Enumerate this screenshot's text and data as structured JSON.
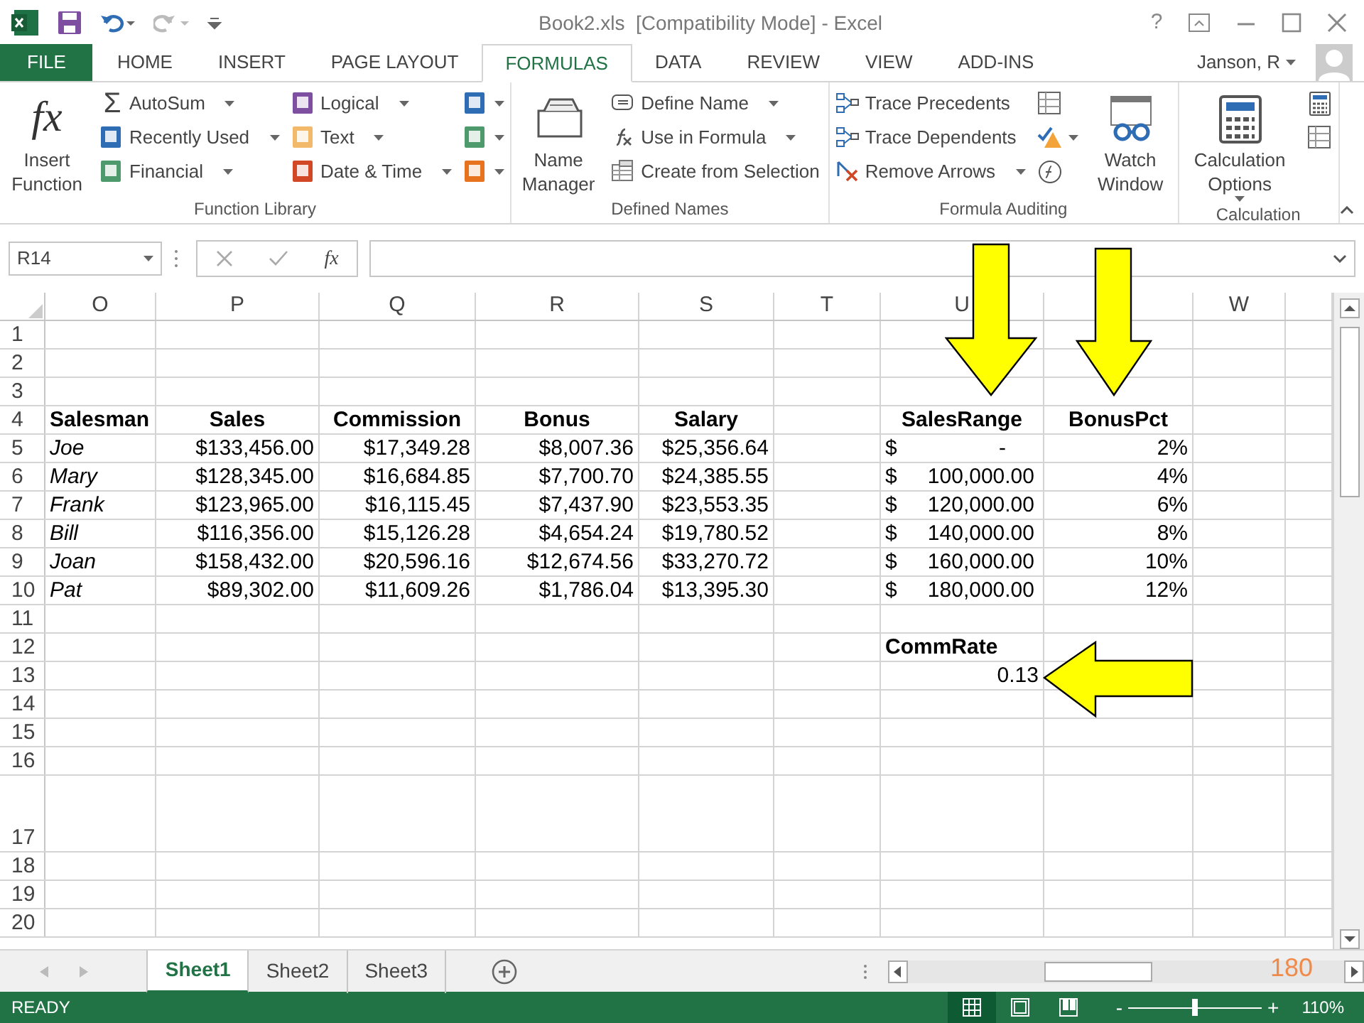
{
  "title_bar": {
    "title": "Book2.xls  [Compatibility Mode] - Excel",
    "help": "?"
  },
  "menu_tabs": [
    {
      "label": "FILE",
      "kind": "file",
      "selected": false
    },
    {
      "label": "HOME",
      "kind": "tab",
      "selected": false
    },
    {
      "label": "INSERT",
      "kind": "tab",
      "selected": false
    },
    {
      "label": "PAGE LAYOUT",
      "kind": "tab",
      "selected": false
    },
    {
      "label": "FORMULAS",
      "kind": "tab",
      "selected": true
    },
    {
      "label": "DATA",
      "kind": "tab",
      "selected": false
    },
    {
      "label": "REVIEW",
      "kind": "tab",
      "selected": false
    },
    {
      "label": "VIEW",
      "kind": "tab",
      "selected": false
    },
    {
      "label": "ADD-INS",
      "kind": "tab",
      "selected": false
    }
  ],
  "account": {
    "name": "Janson, R"
  },
  "ribbon_groups": [
    {
      "label": "Function Library",
      "columns": [
        [
          {
            "kind": "large",
            "label": "Insert Function",
            "glyph": "fx"
          }
        ],
        [
          {
            "kind": "small",
            "label": "AutoSum",
            "glyph": "Σ",
            "dropdown": true
          },
          {
            "kind": "small",
            "label": "Recently Used",
            "color": "#2e6db4",
            "dropdown": true
          },
          {
            "kind": "small",
            "label": "Financial",
            "color": "#4f9a6d",
            "dropdown": true
          }
        ],
        [
          {
            "kind": "small",
            "label": "Logical",
            "color": "#7e4fa0",
            "dropdown": true
          },
          {
            "kind": "small",
            "label": "Text",
            "color": "#f2b96a",
            "dropdown": true
          },
          {
            "kind": "small",
            "label": "Date & Time",
            "color": "#d24726",
            "dropdown": true
          }
        ],
        [
          {
            "kind": "icon",
            "color": "#2e6db4",
            "dropdown": true
          },
          {
            "kind": "icon",
            "color": "#4f9a6d",
            "dropdown": true
          },
          {
            "kind": "icon",
            "color": "#e8731e",
            "dropdown": true
          }
        ]
      ]
    },
    {
      "label": "Defined Names",
      "columns": [
        [
          {
            "kind": "large",
            "label": "Name Manager"
          }
        ],
        [
          {
            "kind": "small",
            "label": "Define Name",
            "dropdown": true
          },
          {
            "kind": "small",
            "label": "Use in Formula",
            "dropdown": true
          },
          {
            "kind": "small",
            "label": "Create from Selection"
          }
        ]
      ]
    },
    {
      "label": "Formula Auditing",
      "columns": [
        [
          {
            "kind": "small",
            "label": "Trace Precedents"
          },
          {
            "kind": "small",
            "label": "Trace Dependents"
          },
          {
            "kind": "small",
            "label": "Remove Arrows",
            "dropdown": true
          }
        ],
        [
          {
            "kind": "icon"
          },
          {
            "kind": "icon",
            "dropdown": true
          },
          {
            "kind": "icon"
          }
        ],
        [
          {
            "kind": "large",
            "label": "Watch Window"
          }
        ]
      ]
    },
    {
      "label": "Calculation",
      "columns": [
        [
          {
            "kind": "large",
            "label": "Calculation Options",
            "dropdown": true
          }
        ],
        [
          {
            "kind": "icon"
          },
          {
            "kind": "icon"
          }
        ]
      ]
    }
  ],
  "formula_bar": {
    "name_box": "R14",
    "fx": "fx"
  },
  "sheet": {
    "columns": [
      {
        "label": "O"
      },
      {
        "label": "P"
      },
      {
        "label": "Q"
      },
      {
        "label": "R"
      },
      {
        "label": "S"
      },
      {
        "label": "T"
      },
      {
        "label": "U"
      },
      {},
      {
        "label": "W"
      },
      {}
    ],
    "rows": [
      {
        "number": "1"
      },
      {
        "number": "2"
      },
      {
        "number": "3"
      },
      {
        "number": "4",
        "cells": [
          {
            "kind": "label",
            "text": "Salesman"
          },
          {
            "kind": "header",
            "text": "Sales"
          },
          {
            "kind": "header",
            "text": "Commission"
          },
          {
            "kind": "header",
            "text": "Bonus"
          },
          {
            "kind": "header",
            "text": "Salary"
          },
          null,
          {
            "kind": "header",
            "text": "SalesRange"
          },
          {
            "kind": "header",
            "text": "BonusPct"
          }
        ]
      },
      {
        "number": "5",
        "cells": [
          {
            "kind": "name",
            "text": "Joe"
          },
          {
            "kind": "number",
            "text": "$133,456.00"
          },
          {
            "kind": "number",
            "text": "$17,349.28"
          },
          {
            "kind": "number",
            "text": "$8,007.36"
          },
          {
            "kind": "number",
            "text": "$25,356.64"
          },
          null,
          {
            "kind": "accounting",
            "symbol": "$",
            "text": "-"
          },
          {
            "kind": "number",
            "text": "2%"
          }
        ]
      },
      {
        "number": "6",
        "cells": [
          {
            "kind": "name",
            "text": "Mary"
          },
          {
            "kind": "number",
            "text": "$128,345.00"
          },
          {
            "kind": "number",
            "text": "$16,684.85"
          },
          {
            "kind": "number",
            "text": "$7,700.70"
          },
          {
            "kind": "number",
            "text": "$24,385.55"
          },
          null,
          {
            "kind": "accounting",
            "symbol": "$",
            "text": "100,000.00"
          },
          {
            "kind": "number",
            "text": "4%"
          }
        ]
      },
      {
        "number": "7",
        "cells": [
          {
            "kind": "name",
            "text": "Frank"
          },
          {
            "kind": "number",
            "text": "$123,965.00"
          },
          {
            "kind": "number",
            "text": "$16,115.45"
          },
          {
            "kind": "number",
            "text": "$7,437.90"
          },
          {
            "kind": "number",
            "text": "$23,553.35"
          },
          null,
          {
            "kind": "accounting",
            "symbol": "$",
            "text": "120,000.00"
          },
          {
            "kind": "number",
            "text": "6%"
          }
        ]
      },
      {
        "number": "8",
        "cells": [
          {
            "kind": "name",
            "text": "Bill"
          },
          {
            "kind": "number",
            "text": "$116,356.00"
          },
          {
            "kind": "number",
            "text": "$15,126.28"
          },
          {
            "kind": "number",
            "text": "$4,654.24"
          },
          {
            "kind": "number",
            "text": "$19,780.52"
          },
          null,
          {
            "kind": "accounting",
            "symbol": "$",
            "text": "140,000.00"
          },
          {
            "kind": "number",
            "text": "8%"
          }
        ]
      },
      {
        "number": "9",
        "cells": [
          {
            "kind": "name",
            "text": "Joan"
          },
          {
            "kind": "number",
            "text": "$158,432.00"
          },
          {
            "kind": "number",
            "text": "$20,596.16"
          },
          {
            "kind": "number",
            "text": "$12,674.56"
          },
          {
            "kind": "number",
            "text": "$33,270.72"
          },
          null,
          {
            "kind": "accounting",
            "symbol": "$",
            "text": "160,000.00"
          },
          {
            "kind": "number",
            "text": "10%"
          }
        ]
      },
      {
        "number": "10",
        "cells": [
          {
            "kind": "name",
            "text": "Pat"
          },
          {
            "kind": "number",
            "text": "$89,302.00"
          },
          {
            "kind": "number",
            "text": "$11,609.26"
          },
          {
            "kind": "number",
            "text": "$1,786.04"
          },
          {
            "kind": "number",
            "text": "$13,395.30"
          },
          null,
          {
            "kind": "accounting",
            "symbol": "$",
            "text": "180,000.00"
          },
          {
            "kind": "number",
            "text": "12%"
          }
        ]
      },
      {
        "number": "11"
      },
      {
        "number": "12",
        "cells": [
          null,
          null,
          null,
          null,
          null,
          null,
          {
            "kind": "label",
            "text": "CommRate"
          }
        ]
      },
      {
        "number": "13",
        "cells": [
          null,
          null,
          null,
          null,
          null,
          null,
          {
            "kind": "number",
            "text": "0.13"
          }
        ]
      },
      {
        "number": "14"
      },
      {
        "number": "15"
      },
      {
        "number": "16"
      },
      {
        "number": "17"
      },
      {
        "number": "18"
      },
      {
        "number": "19"
      },
      {
        "number": "20"
      }
    ]
  },
  "sheet_tabs": [
    {
      "label": "Sheet1",
      "selected": true
    },
    {
      "label": "Sheet2",
      "selected": false
    },
    {
      "label": "Sheet3",
      "selected": false
    }
  ],
  "slide_number": "180",
  "status_bar": {
    "status": "READY",
    "views": [
      {
        "selected": true
      },
      {
        "selected": false
      },
      {
        "selected": false
      }
    ],
    "zoom_out": "-",
    "zoom_in": "+",
    "zoom": {
      "level": 0.5
    },
    "zoom_label": "110%"
  }
}
